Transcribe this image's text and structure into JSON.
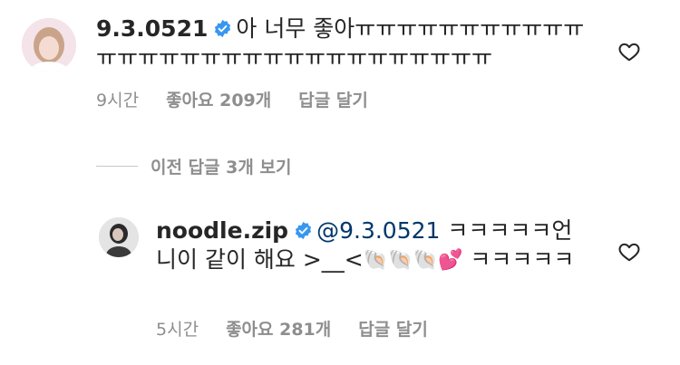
{
  "comment": {
    "username": "9.3.0521",
    "text": "아 너무 좋아ㅠㅠㅠㅠㅠㅠㅠㅠㅠㅠㅠㅠㅠㅠㅠㅠㅠㅠㅠㅠㅠㅠㅠㅠㅠㅠㅠㅠㅠㅠ",
    "time": "9시간",
    "likes": "좋아요 209개",
    "reply_label": "답글 달기"
  },
  "view_previous_replies": "이전 답글 3개 보기",
  "reply": {
    "username": "noodle.zip",
    "mention": "@9.3.0521",
    "text_before": " ㅋㅋㅋㅋㅋ언니이 같이 해요 >__<",
    "emojis": [
      "🐚",
      "🐚",
      "🐚",
      "💕"
    ],
    "text_after": " ㅋㅋㅋㅋㅋ",
    "time": "5시간",
    "likes": "좋아요 281개",
    "reply_label": "답글 달기"
  },
  "colors": {
    "text": "#262626",
    "meta": "#8e8e8e",
    "verified": "#3897f0",
    "mention": "#00376b"
  },
  "icons": [
    "verified-badge-icon",
    "heart-outline-icon"
  ]
}
